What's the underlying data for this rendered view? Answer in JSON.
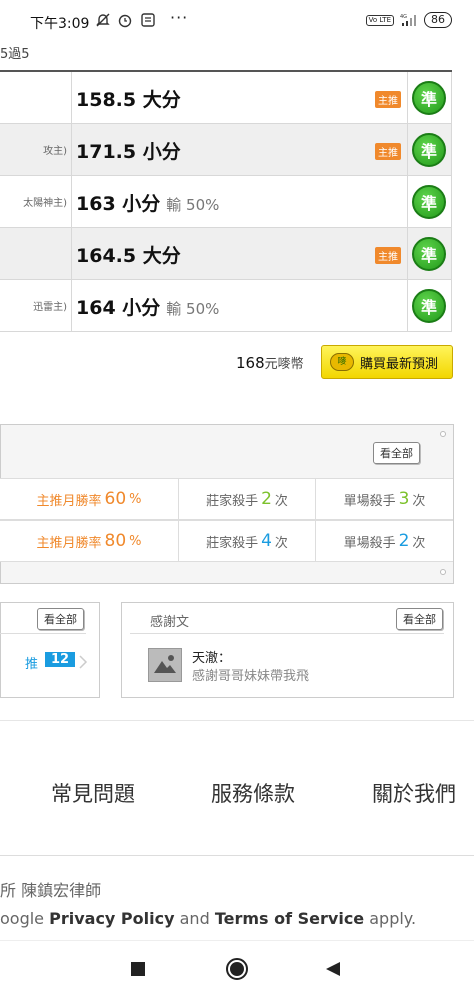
{
  "status_bar": {
    "time": "下午3:09",
    "dots": "···",
    "net": "4G",
    "volte": "Vo LTE",
    "battery": "86"
  },
  "breadcrumb": "5過5",
  "predictions": [
    {
      "team": "",
      "pick": "158.5 大分",
      "loss": "",
      "main_pick": "主推",
      "badge": "準"
    },
    {
      "team": "攻主)",
      "pick": "171.5 小分",
      "loss": "",
      "main_pick": "主推",
      "badge": "準"
    },
    {
      "team": "太陽神主)",
      "pick": "163 小分",
      "loss": "輸 50%",
      "main_pick": "",
      "badge": "準"
    },
    {
      "team": "",
      "pick": "164.5 大分",
      "loss": "",
      "main_pick": "主推",
      "badge": "準"
    },
    {
      "team": "迅雷主)",
      "pick": "164 小分",
      "loss": "輸 50%",
      "main_pick": "",
      "badge": "準"
    }
  ],
  "purchase": {
    "price": "168",
    "unit": "元嘜幣",
    "button_label": "購買最新預測",
    "coin": "嘜"
  },
  "stats": {
    "view_all": "看全部",
    "rows": [
      {
        "rate_label": "主推月勝率",
        "rate": "60",
        "pct": "%",
        "banker_label": "莊家殺手",
        "banker": "2",
        "banker_unit": "次",
        "single_label": "單場殺手",
        "single": "3",
        "single_unit": "次"
      },
      {
        "rate_label": "主推月勝率",
        "rate": "80",
        "pct": "%",
        "banker_label": "莊家殺手",
        "banker": "4",
        "banker_unit": "次",
        "single_label": "單場殺手",
        "single": "2",
        "single_unit": "次"
      }
    ],
    "colors": {
      "rate": "#f0892c",
      "banker_1": "#7cc12b",
      "banker_2": "#1a9ce0",
      "single_1": "#7cc12b",
      "single_2": "#1a9ce0"
    }
  },
  "left_card": {
    "view_all": "看全部",
    "tui": "推",
    "count": "12"
  },
  "thanks_card": {
    "title": "感謝文",
    "view_all": "看全部",
    "author": "天澈：",
    "text": "感謝哥哥妹妹帶我飛"
  },
  "footer": {
    "links": [
      "常見問題",
      "服務條款",
      "關於我們"
    ],
    "lawyer": "所 陳鎮宏律師",
    "recaptcha_pre": "oogle ",
    "privacy": "Privacy Policy",
    "and": " and ",
    "terms": "Terms of Service",
    "apply": " apply."
  }
}
